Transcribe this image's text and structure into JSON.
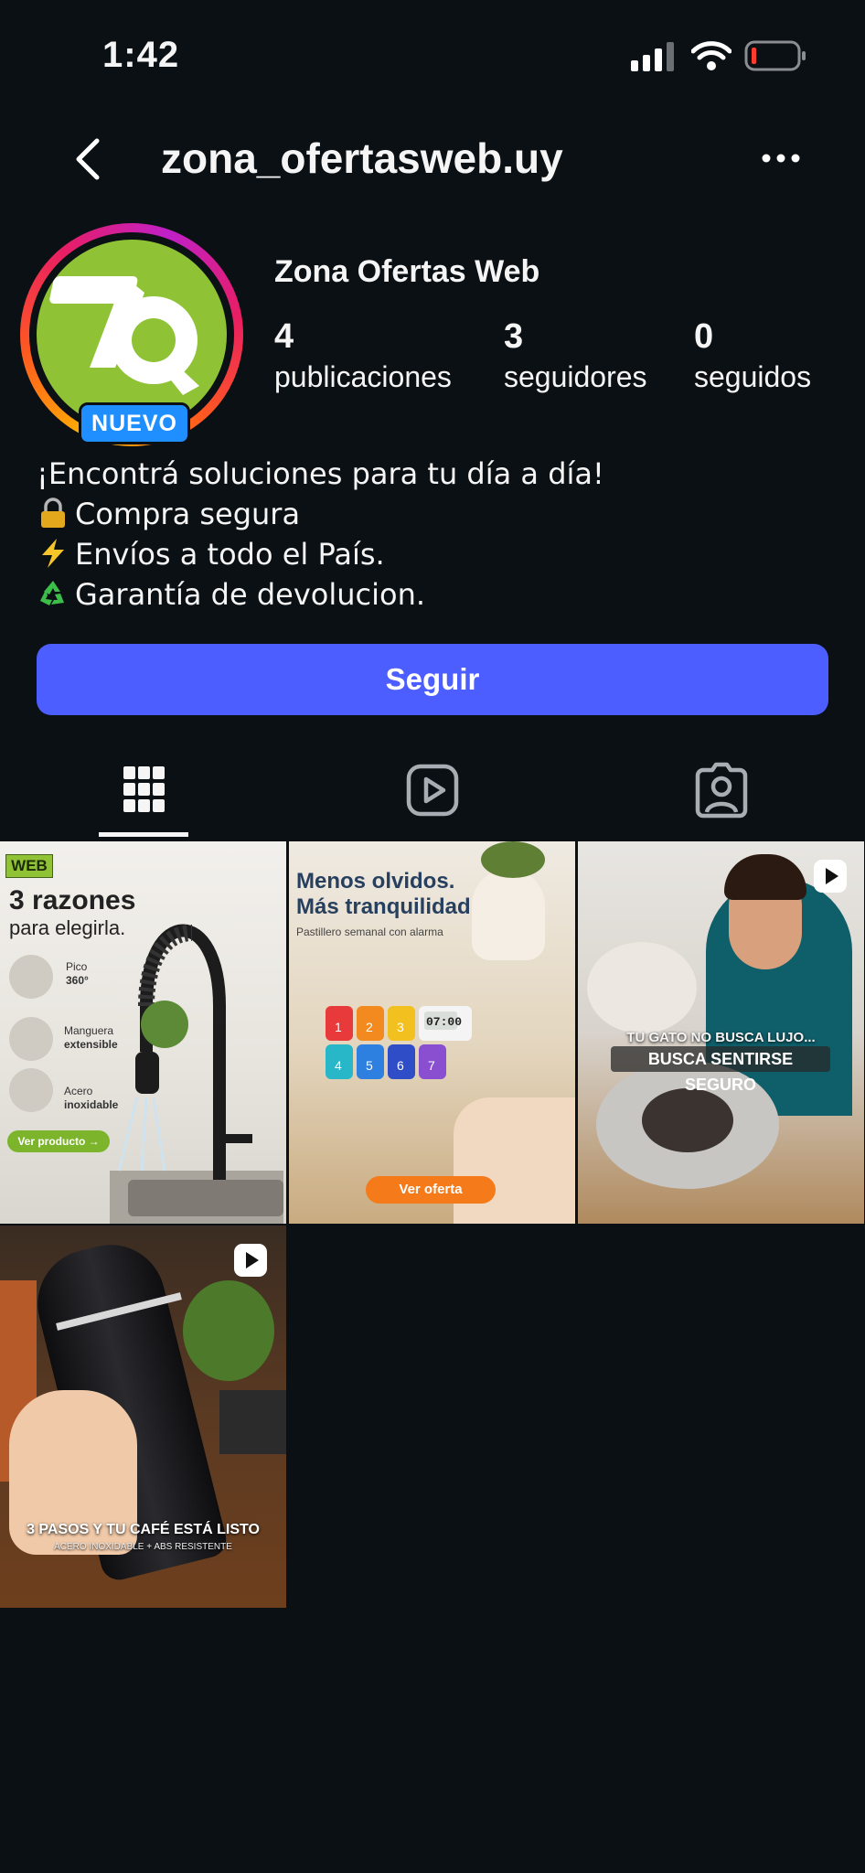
{
  "status_bar": {
    "time": "1:42"
  },
  "header": {
    "username": "zona_ofertasweb.uy"
  },
  "profile": {
    "badge": "NUEVO",
    "display_name": "Zona Ofertas Web",
    "stats": [
      {
        "value": "4",
        "label": "publicaciones"
      },
      {
        "value": "3",
        "label": "seguidores"
      },
      {
        "value": "0",
        "label": "seguidos"
      }
    ]
  },
  "bio": {
    "line1": "¡Encontrá soluciones para tu día a día!",
    "line2": "Compra segura",
    "line3": "Envíos a todo el País.",
    "line4": "Garantía de devolucion."
  },
  "follow_button": {
    "label": "Seguir"
  },
  "tabs": [
    {
      "icon": "grid-icon",
      "active": true
    },
    {
      "icon": "reels-icon",
      "active": false
    },
    {
      "icon": "tagged-icon",
      "active": false
    }
  ],
  "posts": [
    {
      "type": "image",
      "tag": "WEB",
      "headline": "3 razones",
      "sub": "para elegirla.",
      "features": [
        {
          "pre": "Pico",
          "bold": "360°"
        },
        {
          "pre": "Manguera",
          "bold": "extensible"
        },
        {
          "pre": "Acero",
          "bold": "inoxidable"
        }
      ],
      "cta": "Ver producto →"
    },
    {
      "type": "image",
      "headline1": "Menos olvidos.",
      "headline2": "Más tranquilidad.",
      "sub": "Pastillero semanal con alarma",
      "clock": "07:00",
      "cta": "Ver oferta"
    },
    {
      "type": "reel",
      "caption1": "TU GATO NO BUSCA LUJO...",
      "caption2": "BUSCA SENTIRSE SEGURO"
    },
    {
      "type": "reel",
      "caption1": "3 PASOS Y TU CAFÉ ESTÁ LISTO",
      "caption2": "ACERO INOXIDABLE + ABS RESISTENTE"
    }
  ],
  "colors": {
    "background": "#0b1014",
    "button": "#4c5eff",
    "badge": "#1f8fff",
    "logo_green": "#8fc234"
  }
}
